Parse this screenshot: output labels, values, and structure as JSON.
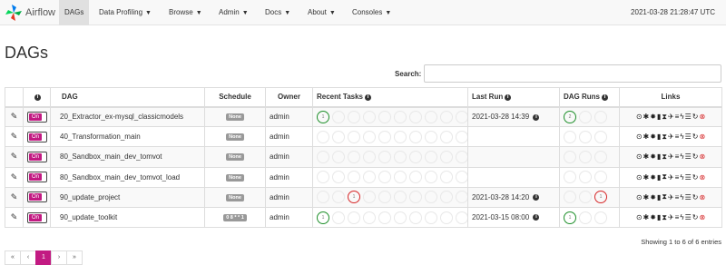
{
  "navbar": {
    "brand": "Airflow",
    "items": [
      {
        "label": "DAGs",
        "caret": false
      },
      {
        "label": "Data Profiling",
        "caret": true
      },
      {
        "label": "Browse",
        "caret": true
      },
      {
        "label": "Admin",
        "caret": true
      },
      {
        "label": "Docs",
        "caret": true
      },
      {
        "label": "About",
        "caret": true
      },
      {
        "label": "Consoles",
        "caret": true
      }
    ],
    "clock": "2021-03-28 21:28:47 UTC"
  },
  "page": {
    "title": "DAGs",
    "search_label": "Search:",
    "search_value": ""
  },
  "table": {
    "headers": {
      "dag": "DAG",
      "schedule": "Schedule",
      "owner": "Owner",
      "recent_tasks": "Recent Tasks",
      "last_run": "Last Run",
      "dag_runs": "DAG Runs",
      "links": "Links"
    },
    "toggle_label": "On",
    "rows": [
      {
        "dag": "20_Extractor_ex-mysql_classicmodels",
        "schedule": "None",
        "owner": "admin",
        "last_run": "2021-03-28 14:39",
        "recent_tasks": [
          "green:1",
          "",
          "",
          "",
          "",
          "",
          "",
          "",
          "",
          ""
        ],
        "dag_runs": [
          "green:2",
          "",
          ""
        ]
      },
      {
        "dag": "40_Transformation_main",
        "schedule": "None",
        "owner": "admin",
        "last_run": "",
        "recent_tasks": [
          "",
          "",
          "",
          "",
          "",
          "",
          "",
          "",
          "",
          ""
        ],
        "dag_runs": [
          "",
          "",
          ""
        ]
      },
      {
        "dag": "80_Sandbox_main_dev_tomvot",
        "schedule": "None",
        "owner": "admin",
        "last_run": "",
        "recent_tasks": [
          "",
          "",
          "",
          "",
          "",
          "",
          "",
          "",
          "",
          ""
        ],
        "dag_runs": [
          "",
          "",
          ""
        ]
      },
      {
        "dag": "80_Sandbox_main_dev_tomvot_load",
        "schedule": "None",
        "owner": "admin",
        "last_run": "",
        "recent_tasks": [
          "",
          "",
          "",
          "",
          "",
          "",
          "",
          "",
          "",
          ""
        ],
        "dag_runs": [
          "",
          "",
          ""
        ]
      },
      {
        "dag": "90_update_project",
        "schedule": "None",
        "owner": "admin",
        "last_run": "2021-03-28 14:20",
        "recent_tasks": [
          "",
          "",
          "red:1",
          "",
          "",
          "",
          "",
          "",
          "",
          ""
        ],
        "dag_runs": [
          "",
          "",
          "red:1"
        ]
      },
      {
        "dag": "90_update_toolkit",
        "schedule": "0 8 * * 1",
        "owner": "admin",
        "last_run": "2021-03-15 08:00",
        "recent_tasks": [
          "green:1",
          "",
          "",
          "",
          "",
          "",
          "",
          "",
          "",
          ""
        ],
        "dag_runs": [
          "green:1",
          "",
          ""
        ]
      }
    ],
    "links_icons": [
      "play-circle-icon",
      "tree-icon",
      "gantt-icon",
      "bar-chart-icon",
      "hourglass-icon",
      "plane-icon",
      "list-icon",
      "bolt-icon",
      "lines-icon",
      "refresh-icon",
      "delete-icon"
    ]
  },
  "footer": {
    "showing": "Showing 1 to 6 of 6 entries",
    "pagination": [
      "«",
      "‹",
      "1",
      "›",
      "»"
    ],
    "active_page": "1"
  },
  "colors": {
    "accent": "#c21a82",
    "success": "#1e8f2a",
    "failed": "#d62728"
  }
}
